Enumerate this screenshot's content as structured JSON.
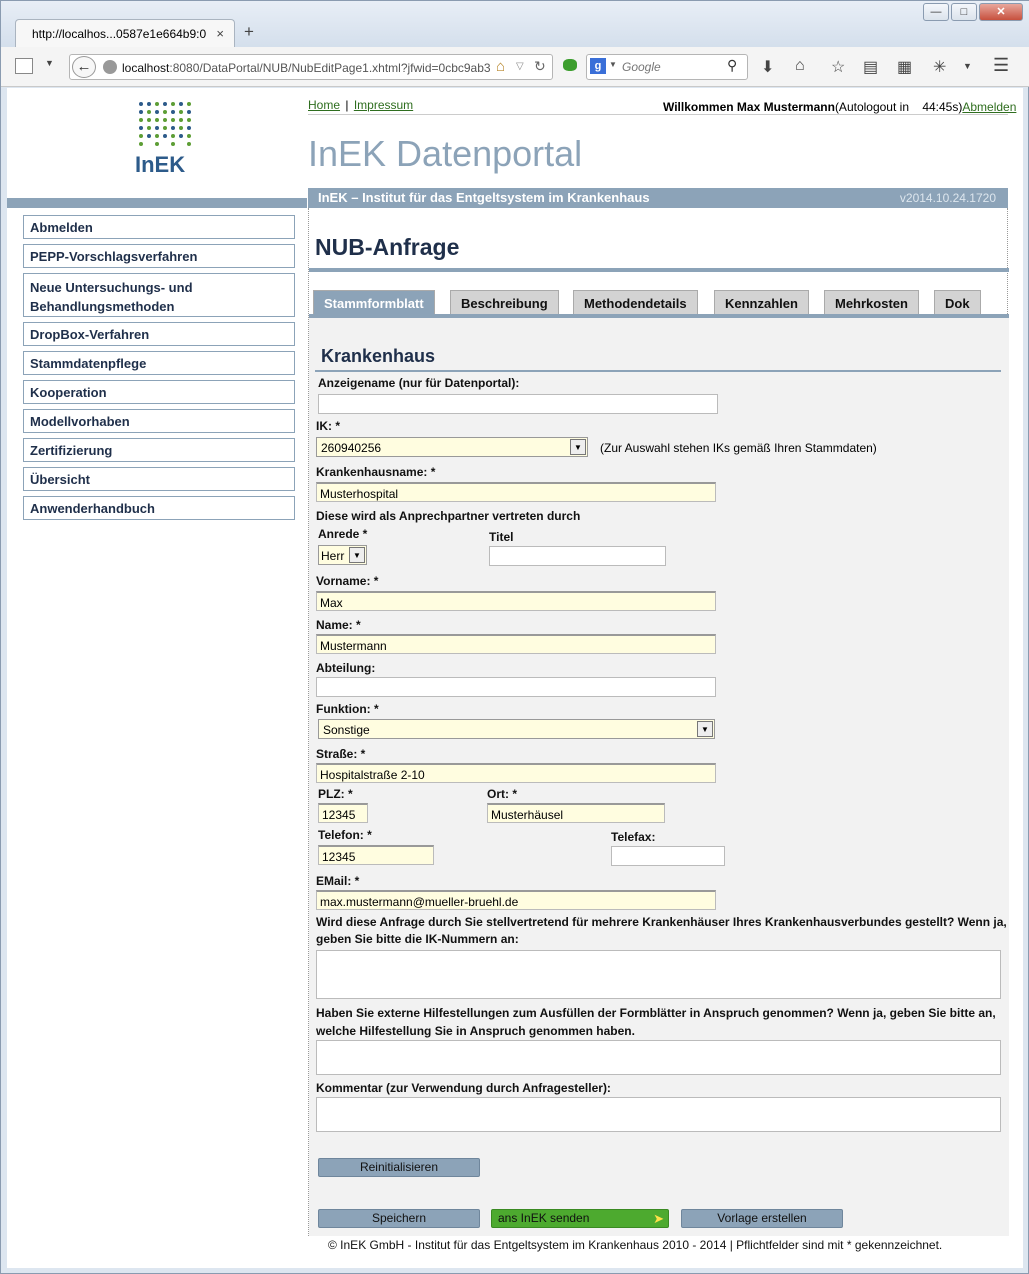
{
  "browser": {
    "tab_title": "http://localhos...0587e1e664b9:0",
    "tab_close": "×",
    "new_tab": "+",
    "url_host": "localhost",
    "url_rest": ":8080/DataPortal/NUB/NubEditPage1.xhtml?jfwid=0cbc9ab3",
    "search_engine": "Google",
    "search_placeholder": "Google"
  },
  "header": {
    "logo_text": "InEK",
    "home_link": "Home",
    "separator": "|",
    "impressum_link": "Impressum",
    "welcome": "Willkommen Max Mustermann",
    "autologout": "(Autologout in    44:45s)",
    "logout_link": "Abmelden",
    "portal_title": "InEK Datenportal",
    "band_title": "InEK – Institut für das Entgeltsystem im Krankenhaus",
    "version": "v2014.10.24.1720"
  },
  "sidebar": {
    "items": [
      {
        "label": "Abmelden"
      },
      {
        "label": "PEPP-Vorschlagsverfahren"
      },
      {
        "label": "Neue Untersuchungs- und Behandlungsmethoden"
      },
      {
        "label": "DropBox-Verfahren"
      },
      {
        "label": "Stammdatenpflege"
      },
      {
        "label": "Kooperation"
      },
      {
        "label": "Modellvorhaben"
      },
      {
        "label": "Zertifizierung"
      },
      {
        "label": "Übersicht"
      },
      {
        "label": "Anwenderhandbuch"
      }
    ]
  },
  "main": {
    "page_title": "NUB-Anfrage",
    "tabs": [
      {
        "label": "Stammformblatt"
      },
      {
        "label": "Beschreibung"
      },
      {
        "label": "Methodendetails"
      },
      {
        "label": "Kennzahlen"
      },
      {
        "label": "Mehrkosten"
      },
      {
        "label": "Dok"
      }
    ],
    "section_title": "Krankenhaus"
  },
  "form": {
    "anzeigename_label": "Anzeigename (nur für Datenportal):",
    "anzeigename_value": "",
    "ik_label": "IK: *",
    "ik_value": "260940256",
    "ik_hint": "(Zur Auswahl stehen IKs gemäß Ihren Stammdaten)",
    "krankenhausname_label": "Krankenhausname: *",
    "krankenhausname_value": "Musterhospital",
    "ansprechpartner_label": "Diese wird als Anprechpartner vertreten durch",
    "anrede_label": "Anrede *",
    "anrede_value": "Herr",
    "titel_label": "Titel",
    "titel_value": "",
    "vorname_label": "Vorname: *",
    "vorname_value": "Max",
    "name_label": "Name: *",
    "name_value": "Mustermann",
    "abteilung_label": "Abteilung:",
    "abteilung_value": "",
    "funktion_label": "Funktion: *",
    "funktion_value": "Sonstige",
    "strasse_label": "Straße: *",
    "strasse_value": "Hospitalstraße 2-10",
    "plz_label": "PLZ: *",
    "plz_value": "12345",
    "ort_label": "Ort: *",
    "ort_value": "Musterhäusel",
    "telefon_label": "Telefon: *",
    "telefon_value": "12345",
    "telefax_label": "Telefax:",
    "telefax_value": "",
    "email_label": "EMail: *",
    "email_value": "max.mustermann@mueller-bruehl.de",
    "verbund_label_1": "Wird diese Anfrage durch Sie stellvertretend für mehrere Krankenhäuser Ihres Krankenhausverbundes gestellt? Wenn ja,",
    "verbund_label_2": "geben Sie bitte die IK-Nummern an:",
    "hilfe_label_1": "Haben Sie externe Hilfestellungen zum Ausfüllen der Formblätter in Anspruch genommen? Wenn ja, geben Sie bitte an,",
    "hilfe_label_2": "welche Hilfestellung Sie in Anspruch genommen haben.",
    "kommentar_label": "Kommentar (zur Verwendung durch Anfragesteller):",
    "reinit_button": "Reinitialisieren",
    "save_button": "Speichern",
    "send_button": "ans InEK senden",
    "template_button": "Vorlage erstellen"
  },
  "footer": {
    "text": "© InEK GmbH - Institut für das Entgeltsystem im Krankenhaus 2010 - 2014 | Pflichtfelder sind mit * gekennzeichnet."
  },
  "colors": {
    "accent": "#8ca3b8",
    "required_bg": "#fffde0",
    "send_green": "#4daa2f",
    "link_green": "#2f6e1f"
  }
}
